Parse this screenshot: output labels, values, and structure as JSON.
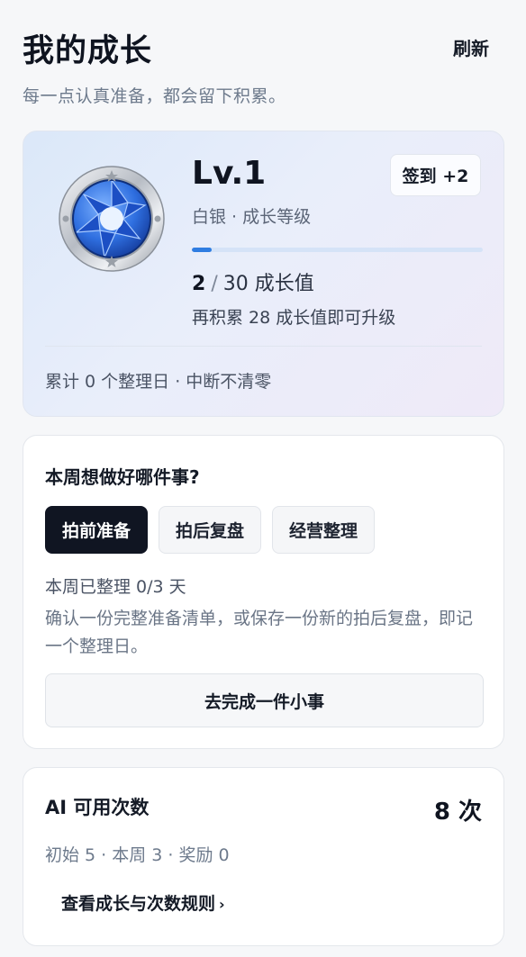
{
  "header": {
    "title": "我的成长",
    "refresh_label": "刷新",
    "subtitle": "每一点认真准备，都会留下积累。"
  },
  "level": {
    "badge_icon": "camera-aperture-icon",
    "title": "Lv.1",
    "rank": "白银 · 成长等级",
    "checkin_label": "签到 +2",
    "current": "2",
    "separator": "/",
    "target": "30 成长值",
    "progress_fraction": 0.067,
    "upgrade_hint": "再积累 28 成长值即可升级",
    "cumulative": "累计 0 个整理日 · 中断不清零",
    "accent_color": "#2f7de1"
  },
  "task": {
    "title": "本周想做好哪件事?",
    "tabs": [
      {
        "label": "拍前准备",
        "active": true
      },
      {
        "label": "拍后复盘",
        "active": false
      },
      {
        "label": "经营整理",
        "active": false
      }
    ],
    "week_count": "本周已整理 0/3 天",
    "description": "确认一份完整准备清单，或保存一份新的拍后复盘，即记一个整理日。",
    "action_label": "去完成一件小事"
  },
  "ai": {
    "title": "AI 可用次数",
    "count": "8 次",
    "breakdown": "初始 5 · 本周 3 · 奖励 0",
    "rules_link": "查看成长与次数规则",
    "rules_chevron": "›"
  }
}
